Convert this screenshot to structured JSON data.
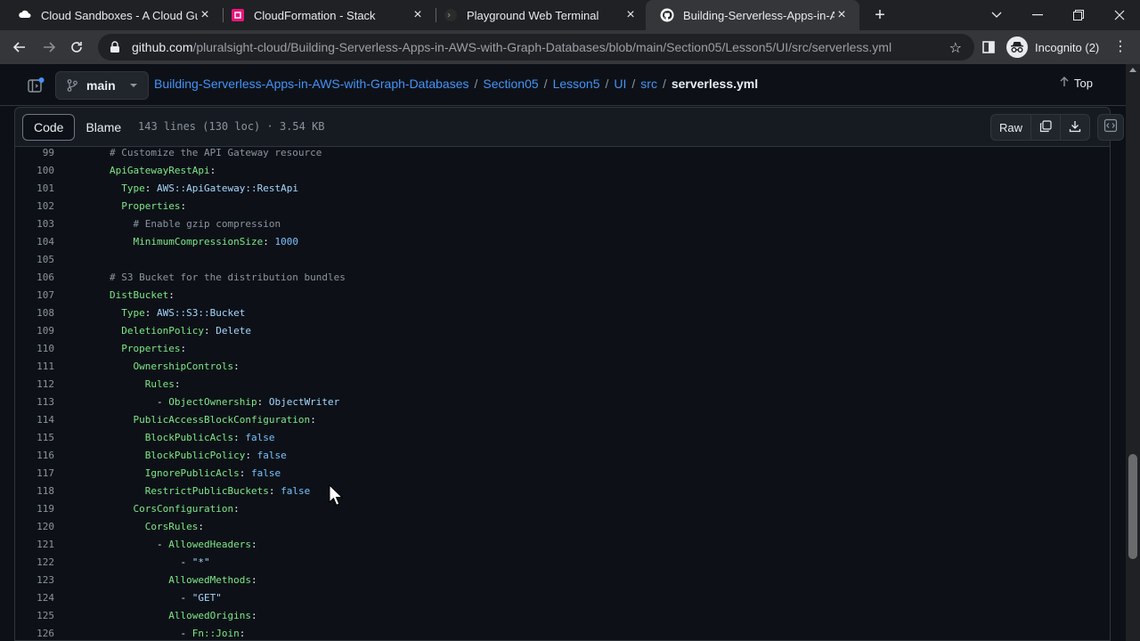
{
  "browser": {
    "tabs": [
      {
        "title": "Cloud Sandboxes - A Cloud Guru",
        "icon": "acloudguru-icon",
        "active": false
      },
      {
        "title": "CloudFormation - Stack",
        "icon": "cloudformation-icon",
        "active": false
      },
      {
        "title": "Playground Web Terminal",
        "icon": "terminal-icon",
        "active": false
      },
      {
        "title": "Building-Serverless-Apps-in-AWS",
        "icon": "github-icon",
        "active": true
      }
    ],
    "url_domain": "github.com",
    "url_path": "/pluralsight-cloud/Building-Serverless-Apps-in-AWS-with-Graph-Databases/blob/main/Section05/Lesson5/UI/src/serverless.yml",
    "profile_label": "Incognito (2)"
  },
  "repo": {
    "branch": "main",
    "breadcrumb": [
      "Building-Serverless-Apps-in-AWS-with-Graph-Databases",
      "Section05",
      "Lesson5",
      "UI",
      "src"
    ],
    "file_name": "serverless.yml",
    "top_label": "Top"
  },
  "file": {
    "tab_code": "Code",
    "tab_blame": "Blame",
    "info": "143 lines (130 loc) · 3.54 KB",
    "raw_label": "Raw"
  },
  "colors": {
    "link": "#4493f8",
    "key": "#7ee787",
    "comment": "#8b949e",
    "string": "#a5d6ff",
    "number": "#79c0ff"
  },
  "code_lines": [
    {
      "n": "99",
      "parts": [
        {
          "t": "# Customize the API Gateway resource",
          "c": "c"
        }
      ],
      "indent": 0
    },
    {
      "n": "100",
      "parts": [
        {
          "t": "ApiGatewayRestApi",
          "c": "k"
        },
        {
          "t": ":",
          "c": "p"
        }
      ],
      "indent": 0
    },
    {
      "n": "101",
      "parts": [
        {
          "t": "Type",
          "c": "k"
        },
        {
          "t": ": ",
          "c": "p"
        },
        {
          "t": "AWS::ApiGateway::RestApi",
          "c": "v"
        }
      ],
      "indent": 2
    },
    {
      "n": "102",
      "parts": [
        {
          "t": "Properties",
          "c": "k"
        },
        {
          "t": ":",
          "c": "p"
        }
      ],
      "indent": 2
    },
    {
      "n": "103",
      "parts": [
        {
          "t": "# Enable gzip compression",
          "c": "c"
        }
      ],
      "indent": 4
    },
    {
      "n": "104",
      "parts": [
        {
          "t": "MinimumCompressionSize",
          "c": "k"
        },
        {
          "t": ": ",
          "c": "p"
        },
        {
          "t": "1000",
          "c": "n"
        }
      ],
      "indent": 4
    },
    {
      "n": "105",
      "parts": [],
      "indent": 0
    },
    {
      "n": "106",
      "parts": [
        {
          "t": "# S3 Bucket for the distribution bundles",
          "c": "c"
        }
      ],
      "indent": 0
    },
    {
      "n": "107",
      "parts": [
        {
          "t": "DistBucket",
          "c": "k"
        },
        {
          "t": ":",
          "c": "p"
        }
      ],
      "indent": 0
    },
    {
      "n": "108",
      "parts": [
        {
          "t": "Type",
          "c": "k"
        },
        {
          "t": ": ",
          "c": "p"
        },
        {
          "t": "AWS::S3::Bucket",
          "c": "v"
        }
      ],
      "indent": 2
    },
    {
      "n": "109",
      "parts": [
        {
          "t": "DeletionPolicy",
          "c": "k"
        },
        {
          "t": ": ",
          "c": "p"
        },
        {
          "t": "Delete",
          "c": "v"
        }
      ],
      "indent": 2
    },
    {
      "n": "110",
      "parts": [
        {
          "t": "Properties",
          "c": "k"
        },
        {
          "t": ":",
          "c": "p"
        }
      ],
      "indent": 2
    },
    {
      "n": "111",
      "parts": [
        {
          "t": "OwnershipControls",
          "c": "k"
        },
        {
          "t": ":",
          "c": "p"
        }
      ],
      "indent": 4
    },
    {
      "n": "112",
      "parts": [
        {
          "t": "Rules",
          "c": "k"
        },
        {
          "t": ":",
          "c": "p"
        }
      ],
      "indent": 6
    },
    {
      "n": "113",
      "parts": [
        {
          "t": "- ",
          "c": "p"
        },
        {
          "t": "ObjectOwnership",
          "c": "k"
        },
        {
          "t": ": ",
          "c": "p"
        },
        {
          "t": "ObjectWriter",
          "c": "v"
        }
      ],
      "indent": 8
    },
    {
      "n": "114",
      "parts": [
        {
          "t": "PublicAccessBlockConfiguration",
          "c": "k"
        },
        {
          "t": ":",
          "c": "p"
        }
      ],
      "indent": 4
    },
    {
      "n": "115",
      "parts": [
        {
          "t": "BlockPublicAcls",
          "c": "k"
        },
        {
          "t": ": ",
          "c": "p"
        },
        {
          "t": "false",
          "c": "n"
        }
      ],
      "indent": 6
    },
    {
      "n": "116",
      "parts": [
        {
          "t": "BlockPublicPolicy",
          "c": "k"
        },
        {
          "t": ": ",
          "c": "p"
        },
        {
          "t": "false",
          "c": "n"
        }
      ],
      "indent": 6
    },
    {
      "n": "117",
      "parts": [
        {
          "t": "IgnorePublicAcls",
          "c": "k"
        },
        {
          "t": ": ",
          "c": "p"
        },
        {
          "t": "false",
          "c": "n"
        }
      ],
      "indent": 6
    },
    {
      "n": "118",
      "parts": [
        {
          "t": "RestrictPublicBuckets",
          "c": "k"
        },
        {
          "t": ": ",
          "c": "p"
        },
        {
          "t": "false",
          "c": "n"
        }
      ],
      "indent": 6
    },
    {
      "n": "119",
      "parts": [
        {
          "t": "CorsConfiguration",
          "c": "k"
        },
        {
          "t": ":",
          "c": "p"
        }
      ],
      "indent": 4
    },
    {
      "n": "120",
      "parts": [
        {
          "t": "CorsRules",
          "c": "k"
        },
        {
          "t": ":",
          "c": "p"
        }
      ],
      "indent": 6
    },
    {
      "n": "121",
      "parts": [
        {
          "t": "- ",
          "c": "p"
        },
        {
          "t": "AllowedHeaders",
          "c": "k"
        },
        {
          "t": ":",
          "c": "p"
        }
      ],
      "indent": 8
    },
    {
      "n": "122",
      "parts": [
        {
          "t": "- ",
          "c": "p"
        },
        {
          "t": "\"*\"",
          "c": "v"
        }
      ],
      "indent": 12
    },
    {
      "n": "123",
      "parts": [
        {
          "t": "AllowedMethods",
          "c": "k"
        },
        {
          "t": ":",
          "c": "p"
        }
      ],
      "indent": 10
    },
    {
      "n": "124",
      "parts": [
        {
          "t": "- ",
          "c": "p"
        },
        {
          "t": "\"GET\"",
          "c": "v"
        }
      ],
      "indent": 12
    },
    {
      "n": "125",
      "parts": [
        {
          "t": "AllowedOrigins",
          "c": "k"
        },
        {
          "t": ":",
          "c": "p"
        }
      ],
      "indent": 10
    },
    {
      "n": "126",
      "parts": [
        {
          "t": "- ",
          "c": "p"
        },
        {
          "t": "Fn::Join",
          "c": "k"
        },
        {
          "t": ":",
          "c": "p"
        }
      ],
      "indent": 12
    }
  ]
}
